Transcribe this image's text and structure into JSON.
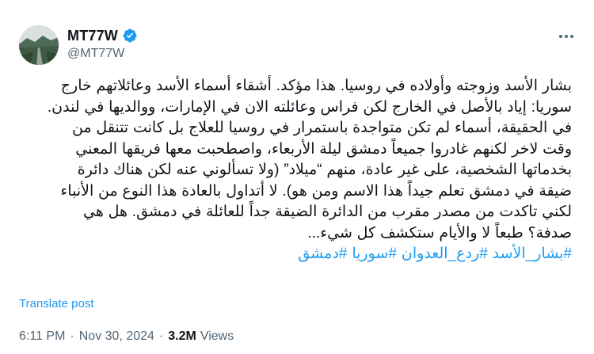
{
  "author": {
    "display_name": "MT77W",
    "handle": "@MT77W",
    "verified": true
  },
  "tweet": {
    "lines": [
      "بشار الأسد وزوجته وأولاده في روسيا. هذا مؤكد. أشقاء أسماء الأسد وعائلاتهم خارج",
      "سوريا: إياد بالأصل في الخارج لكن فراس وعائلته الان في الإمارات، ووالديها في لندن.",
      "في الحقيقة، أسماء لم تكن متواجدة باستمرار في روسيا للعلاج بل كانت تتنقل من",
      "وقت لاخر لكنهم غادروا جميعاً دمشق ليلة الأربعاء، واصطحبت معها فريقها المعني",
      "بخدماتها الشخصية، على غير عادة، منهم “ميلاد” (ولا تسألوني عنه لكن هناك دائرة",
      "ضيقة في دمشق تعلم جيداً هذا الاسم ومن هو). لا أتداول بالعادة هذا النوع من الأنباء",
      "لكني تاكدت من مصدر مقرب من الدائرة الضيقة جداً للعائلة في دمشق. هل هي",
      "صدفة؟ طبعاً لا والأيام ستكشف كل شيء..."
    ],
    "hashtags": [
      "#بشار_الأسد",
      "#ردع_العدوان",
      "#سوريا",
      "#دمشق"
    ]
  },
  "translate_label": "Translate post",
  "meta": {
    "time": "6:11 PM",
    "separator": "·",
    "date": "Nov 30, 2024",
    "views_count": "3.2M",
    "views_label": "Views"
  },
  "icons": {
    "verified": "verified-badge-icon",
    "more": "more-options-icon"
  },
  "colors": {
    "accent": "#1d9bf0",
    "text": "#0f1419",
    "secondary": "#536471"
  }
}
